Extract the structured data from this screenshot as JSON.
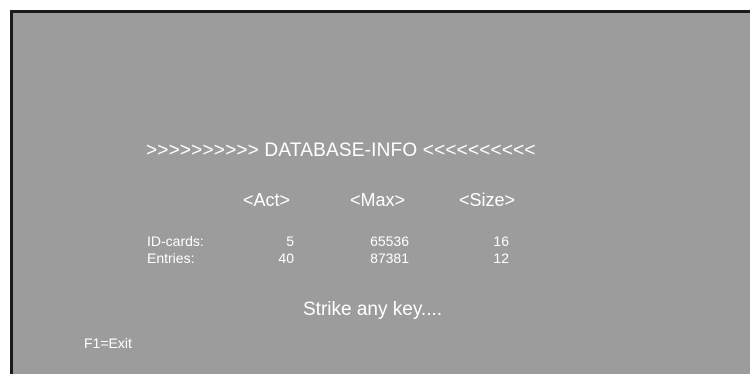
{
  "screen": {
    "title": ">>>>>>>>>> DATABASE-INFO <<<<<<<<<<",
    "headers": {
      "act": "<Act>",
      "max": "<Max>",
      "size": "<Size>"
    },
    "rows": [
      {
        "label": "ID-cards:",
        "act": "5",
        "max": "65536",
        "size": "16"
      },
      {
        "label": "Entries:",
        "act": "40",
        "max": "87381",
        "size": "12"
      }
    ],
    "prompt": "Strike any key....",
    "footer": "F1=Exit"
  },
  "colors": {
    "background": "#9c9c9c",
    "text": "#ffffff",
    "border": "#1a1a1a"
  }
}
